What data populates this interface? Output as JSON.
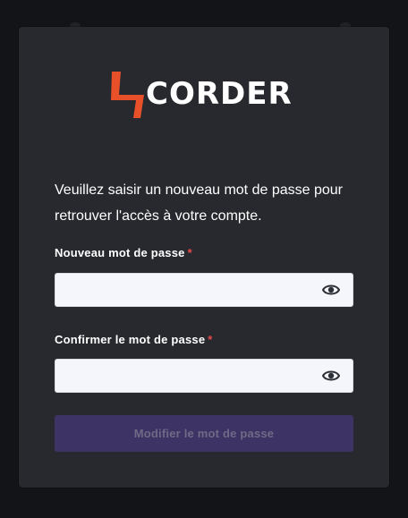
{
  "logo": {
    "text": "CORDER",
    "mark_color": "#e8502a",
    "text_color": "#ffffff"
  },
  "form": {
    "instructions": "Veuillez saisir un nouveau mot de passe pour retrouver l'accès à votre compte.",
    "new_password": {
      "label": "Nouveau mot de passe",
      "required_mark": "*",
      "value": "",
      "icon": "eye-icon"
    },
    "confirm_password": {
      "label": "Confirmer le mot de passe",
      "required_mark": "*",
      "value": "",
      "icon": "eye-icon"
    },
    "submit_label": "Modifier le mot de passe"
  },
  "colors": {
    "background": "#131417",
    "card": "#27292e",
    "input_background": "#f4f6fb",
    "required": "#e64a4a",
    "button_disabled": "#3e3365",
    "button_text_disabled": "#6f6a86"
  }
}
